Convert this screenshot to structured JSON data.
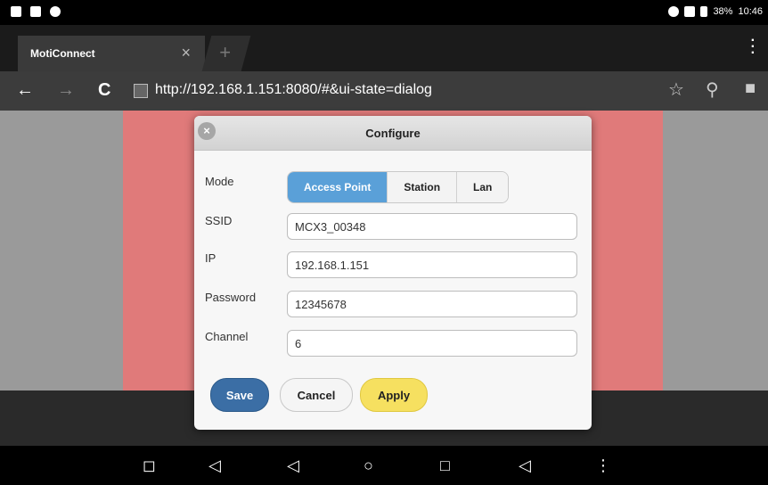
{
  "status": {
    "battery": "38%",
    "time": "10:46"
  },
  "browser": {
    "tab_title": "MotiConnect",
    "tab_close": "×",
    "new_tab": "+",
    "url": "http://192.168.1.151:8080/#&ui-state=dialog",
    "back_icon": "←",
    "forward_icon": "→",
    "reload_icon": "C"
  },
  "dialog": {
    "title": "Configure",
    "close_icon": "×",
    "mode_label": "Mode",
    "modes": [
      "Access Point",
      "Station",
      "Lan"
    ],
    "selected_mode": "Access Point",
    "ssid_label": "SSID",
    "ssid_value": "MCX3_00348",
    "ip_label": "IP",
    "ip_value": "192.168.1.151",
    "password_label": "Password",
    "password_value": "12345678",
    "channel_label": "Channel",
    "channel_value": "6",
    "save_label": "Save",
    "cancel_label": "Cancel",
    "apply_label": "Apply",
    "colors": {
      "active_segment": "#5aa0d8",
      "save": "#3b6ea5",
      "apply": "#f6e060"
    }
  }
}
